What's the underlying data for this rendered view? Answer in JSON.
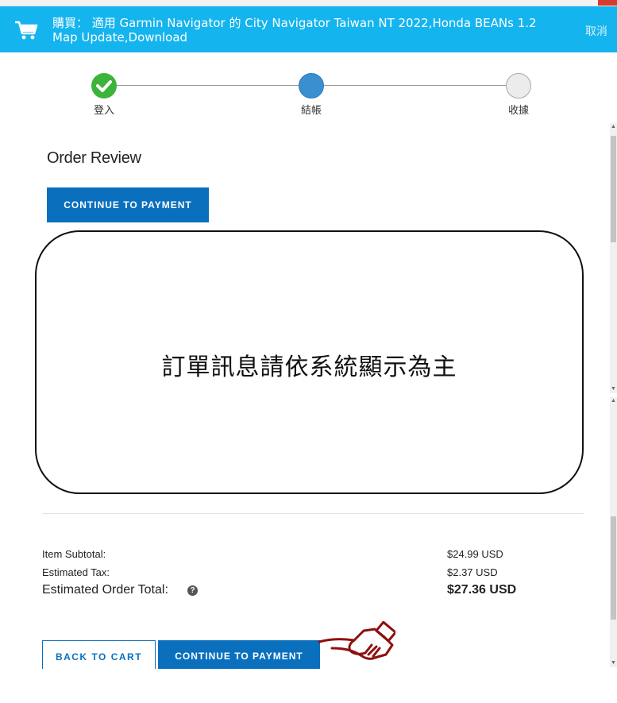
{
  "header": {
    "title": "購買： 適用 Garmin Navigator 的 City Navigator Taiwan NT 2022,Honda BEANs 1.2 Map Update,Download",
    "cancel_label": "取消"
  },
  "stepper": {
    "steps": [
      {
        "label": "登入",
        "state": "done"
      },
      {
        "label": "結帳",
        "state": "current"
      },
      {
        "label": "收據",
        "state": "upcoming"
      }
    ]
  },
  "main": {
    "title": "Order Review",
    "continue_top_label": "CONTINUE TO PAYMENT",
    "notice_text": "訂單訊息請依系統顯示為主"
  },
  "summary": {
    "subtotal_label": "Item Subtotal:",
    "subtotal_value": "$24.99 USD",
    "tax_label": "Estimated Tax:",
    "tax_value": "$2.37 USD",
    "total_label": "Estimated Order Total:",
    "total_value": "$27.36 USD",
    "help_glyph": "?"
  },
  "footer": {
    "back_label": "BACK TO CART",
    "continue_label": "CONTINUE TO PAYMENT"
  },
  "colors": {
    "header_bg": "#14b4ee",
    "primary": "#0a70be",
    "step_done": "#3cb43a",
    "step_current": "#3a8fd1",
    "hand_pointer": "#8e1010"
  },
  "icons": [
    "cart-icon",
    "checkmark-icon",
    "help-icon",
    "hand-pointer-icon",
    "scroll-up-icon",
    "scroll-down-icon"
  ]
}
